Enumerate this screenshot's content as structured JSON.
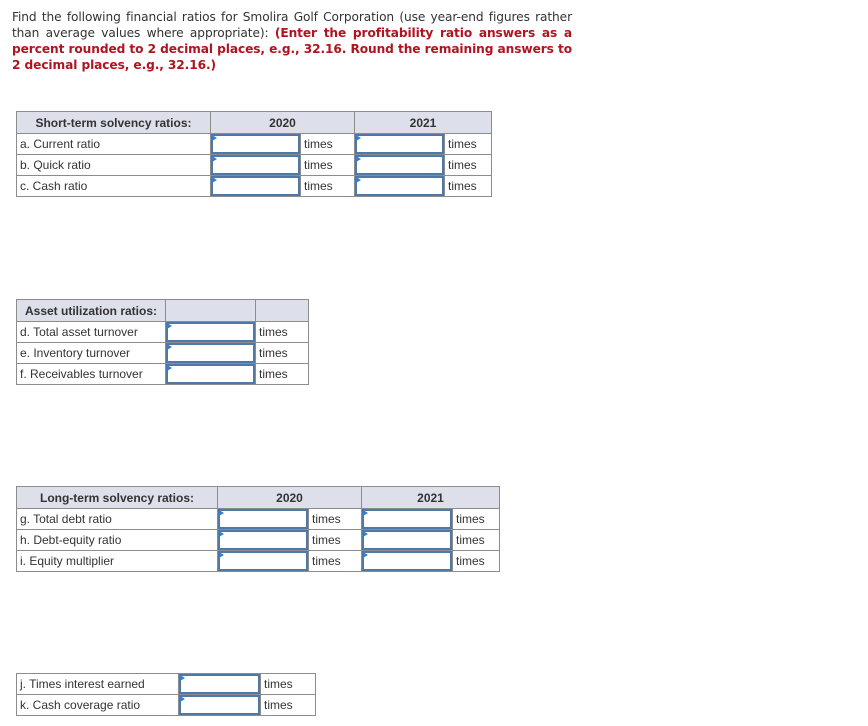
{
  "instructions": {
    "plain": "Find the following financial ratios for Smolira Golf Corporation (use year-end figures rather than average values where appropriate): ",
    "emphasis": "(Enter the profitability ratio answers as a percent rounded to 2 decimal places, e.g., 32.16. Round the remaining answers to 2 decimal places, e.g., 32.16.)"
  },
  "short_term": {
    "header": "Short-term solvency ratios:",
    "years": [
      "2020",
      "2021"
    ],
    "rows": [
      {
        "label": "a. Current ratio",
        "unit": "times",
        "value_2020": "",
        "value_2021": ""
      },
      {
        "label": "b. Quick ratio",
        "unit": "times",
        "value_2020": "",
        "value_2021": ""
      },
      {
        "label": "c. Cash ratio",
        "unit": "times",
        "value_2020": "",
        "value_2021": ""
      }
    ]
  },
  "asset_utilization": {
    "header": "Asset utilization ratios:",
    "rows": [
      {
        "label": "d. Total asset turnover",
        "unit": "times",
        "value": ""
      },
      {
        "label": "e. Inventory turnover",
        "unit": "times",
        "value": ""
      },
      {
        "label": "f. Receivables turnover",
        "unit": "times",
        "value": ""
      }
    ]
  },
  "long_term": {
    "header": "Long-term solvency ratios:",
    "years": [
      "2020",
      "2021"
    ],
    "rows": [
      {
        "label": "g. Total debt ratio",
        "unit": "times",
        "value_2020": "",
        "value_2021": ""
      },
      {
        "label": "h. Debt-equity ratio",
        "unit": "times",
        "value_2020": "",
        "value_2021": ""
      },
      {
        "label": "i. Equity multiplier",
        "unit": "times",
        "value_2020": "",
        "value_2021": ""
      }
    ]
  },
  "coverage": {
    "rows": [
      {
        "label": "j. Times interest earned",
        "unit": "times",
        "value": ""
      },
      {
        "label": "k. Cash coverage ratio",
        "unit": "times",
        "value": ""
      }
    ]
  },
  "colors": {
    "emphasis_text": "#b0141e",
    "header_bg": "#dde0ea",
    "input_border": "#4f78a8",
    "flag": "#2f7fd6"
  }
}
